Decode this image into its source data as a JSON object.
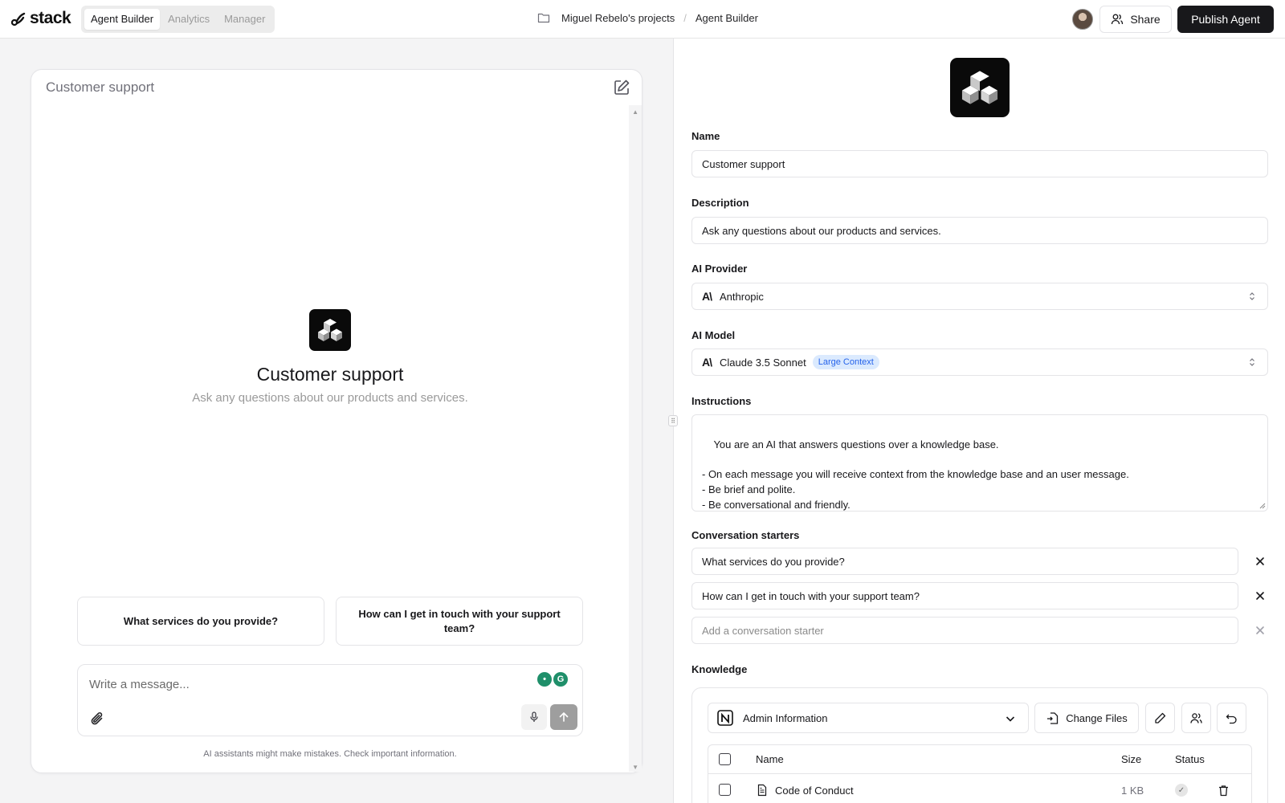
{
  "app": {
    "logo_text": "stack",
    "nav_tabs": [
      {
        "label": "Agent Builder",
        "active": true
      },
      {
        "label": "Analytics",
        "active": false
      },
      {
        "label": "Manager",
        "active": false
      }
    ],
    "breadcrumb": [
      "Miguel Rebelo's projects",
      "Agent Builder"
    ],
    "breadcrumb_separator": "/",
    "share_label": "Share",
    "publish_label": "Publish Agent"
  },
  "preview": {
    "title": "Customer support",
    "agent_name": "Customer support",
    "agent_description": "Ask any questions about our products and services.",
    "starters": [
      "What services do you provide?",
      "How can I get in touch with your support team?"
    ],
    "message_placeholder": "Write a message...",
    "disclaimer": "AI assistants might make mistakes. Check important information."
  },
  "config": {
    "name_label": "Name",
    "name_value": "Customer support",
    "description_label": "Description",
    "description_value": "Ask any questions about our products and services.",
    "provider_label": "AI Provider",
    "provider_value": "Anthropic",
    "provider_mark": "A\\",
    "model_label": "AI Model",
    "model_value": "Claude 3.5 Sonnet",
    "model_badge": "Large Context",
    "instructions_label": "Instructions",
    "instructions_value": "You are an AI that answers questions over a knowledge base.\n\n- On each message you will receive context from the knowledge base and an user message.\n- Be brief and polite.\n- Be conversational and friendly.",
    "starters_label": "Conversation starters",
    "starters": [
      "What services do you provide?",
      "How can I get in touch with your support team?"
    ],
    "starter_placeholder": "Add a conversation starter",
    "knowledge_label": "Knowledge",
    "knowledge_source": "Admin Information",
    "change_files_label": "Change Files",
    "table": {
      "columns": [
        "Name",
        "Size",
        "Status"
      ],
      "rows": [
        {
          "name": "Code of Conduct",
          "size": "1 KB",
          "status": "done"
        }
      ]
    }
  },
  "colors": {
    "accent_dark": "#18181b",
    "badge_bg": "#dbeafe",
    "badge_text": "#2563eb",
    "page_bg": "#f4f4f5"
  },
  "icons": [
    "folder-icon",
    "share-user-icon",
    "edit-icon",
    "paperclip-icon",
    "mic-icon",
    "arrow-up-icon",
    "chevron-updown-icon",
    "close-icon",
    "notion-icon",
    "chevron-down-icon",
    "file-replace-icon",
    "pencil-icon",
    "users-icon",
    "undo-icon",
    "document-icon",
    "check-icon",
    "trash-icon"
  ]
}
